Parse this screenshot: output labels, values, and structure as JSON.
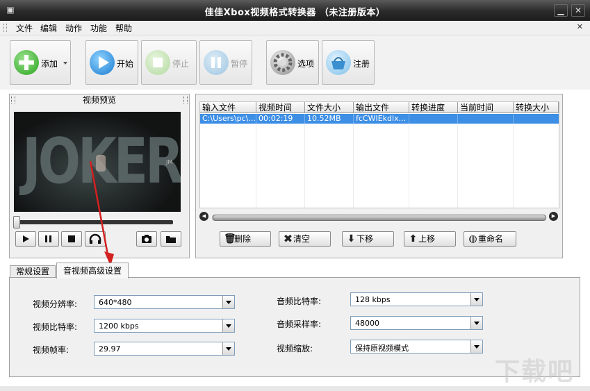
{
  "window": {
    "title": "佳佳Xbox视频格式转换器  （未注册版本）"
  },
  "menu": {
    "items": [
      "文件",
      "编辑",
      "动作",
      "功能",
      "帮助"
    ]
  },
  "toolbar": {
    "add": "添加",
    "start": "开始",
    "stop": "停止",
    "pause": "暂停",
    "options": "选项",
    "register": "注册"
  },
  "preview": {
    "title": "视频预览",
    "overlay_text": "JOKER",
    "overlay_small": "JM"
  },
  "filelist": {
    "columns": [
      "输入文件",
      "视频时间",
      "文件大小",
      "输出文件",
      "转换进度",
      "当前时间",
      "转换大小"
    ],
    "rows": [
      [
        "C:\\Users\\pc\\...",
        "00:02:19",
        "10.52MB",
        "fcCWIEkdlx...",
        "",
        "",
        ""
      ]
    ],
    "buttons": {
      "delete": "删除",
      "clear": "清空",
      "move_down": "下移",
      "move_up": "上移",
      "rename": "重命名"
    }
  },
  "tabs": {
    "general": "常规设置",
    "advanced": "音视频高级设置"
  },
  "settings": {
    "video_resolution": {
      "label": "视频分辨率:",
      "value": "640*480"
    },
    "video_bitrate": {
      "label": "视频比特率:",
      "value": "1200 kbps"
    },
    "video_framerate": {
      "label": "视频帧率:",
      "value": "29.97"
    },
    "audio_bitrate": {
      "label": "音频比特率:",
      "value": "128 kbps"
    },
    "audio_samplerate": {
      "label": "音频采样率:",
      "value": "48000"
    },
    "video_scale": {
      "label": "视频缩放:",
      "value": "保持原视频模式"
    }
  },
  "watermark": "下载吧",
  "colors": {
    "selection": "#3d8ee5",
    "titlebar": "#2a2a2a",
    "annotation_arrow": "#d32020"
  }
}
